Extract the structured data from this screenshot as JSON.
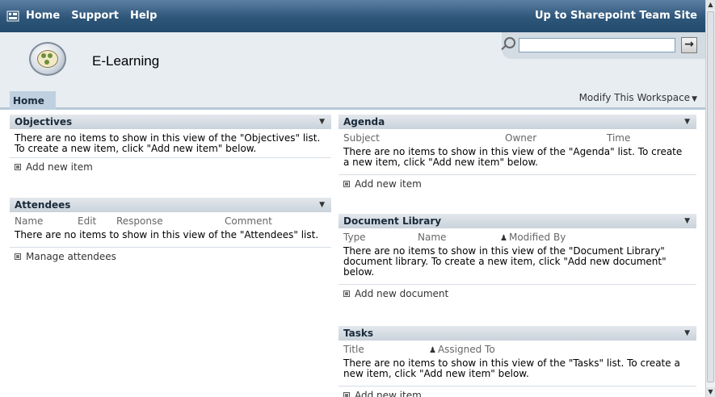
{
  "topnav": {
    "links": [
      "Home",
      "Support",
      "Help"
    ],
    "right_link": "Up to Sharepoint Team Site"
  },
  "site": {
    "title": "E-Learning"
  },
  "search": {
    "value": "",
    "go_label": "→"
  },
  "tabs": {
    "home": "Home",
    "modify": "Modify This Workspace"
  },
  "objectives": {
    "title": "Objectives",
    "empty": "There are no items to show in this view of the \"Objectives\" list. To create a new item, click \"Add new item\" below.",
    "add": "Add new item"
  },
  "attendees": {
    "title": "Attendees",
    "columns": [
      "Name",
      "Edit",
      "Response",
      "Comment"
    ],
    "empty": "There are no items to show in this view of the \"Attendees\" list.",
    "add": "Manage attendees"
  },
  "agenda": {
    "title": "Agenda",
    "columns": [
      "Subject",
      "Owner",
      "Time"
    ],
    "empty": "There are no items to show in this view of the \"Agenda\" list. To create a new item, click \"Add new item\" below.",
    "add": "Add new item"
  },
  "doclib": {
    "title": "Document Library",
    "columns": [
      "Type",
      "Name",
      "Modified By"
    ],
    "empty": "There are no items to show in this view of the \"Document Library\" document library. To create a new item, click \"Add new document\" below.",
    "add": "Add new document"
  },
  "tasks": {
    "title": "Tasks",
    "columns": [
      "Title",
      "Assigned To"
    ],
    "empty": "There are no items to show in this view of the \"Tasks\" list. To create a new item, click \"Add new item\" below.",
    "add": "Add new item"
  },
  "icons": {
    "menu": "chevron-down-icon",
    "bullet": "square-bullet-icon",
    "person": "person-icon",
    "search": "search-icon"
  },
  "colors": {
    "topbar": "#2e5679",
    "header_bg": "#e8edf2",
    "tab_active": "#bfd1e0",
    "wp_title": "#c9d2db"
  }
}
